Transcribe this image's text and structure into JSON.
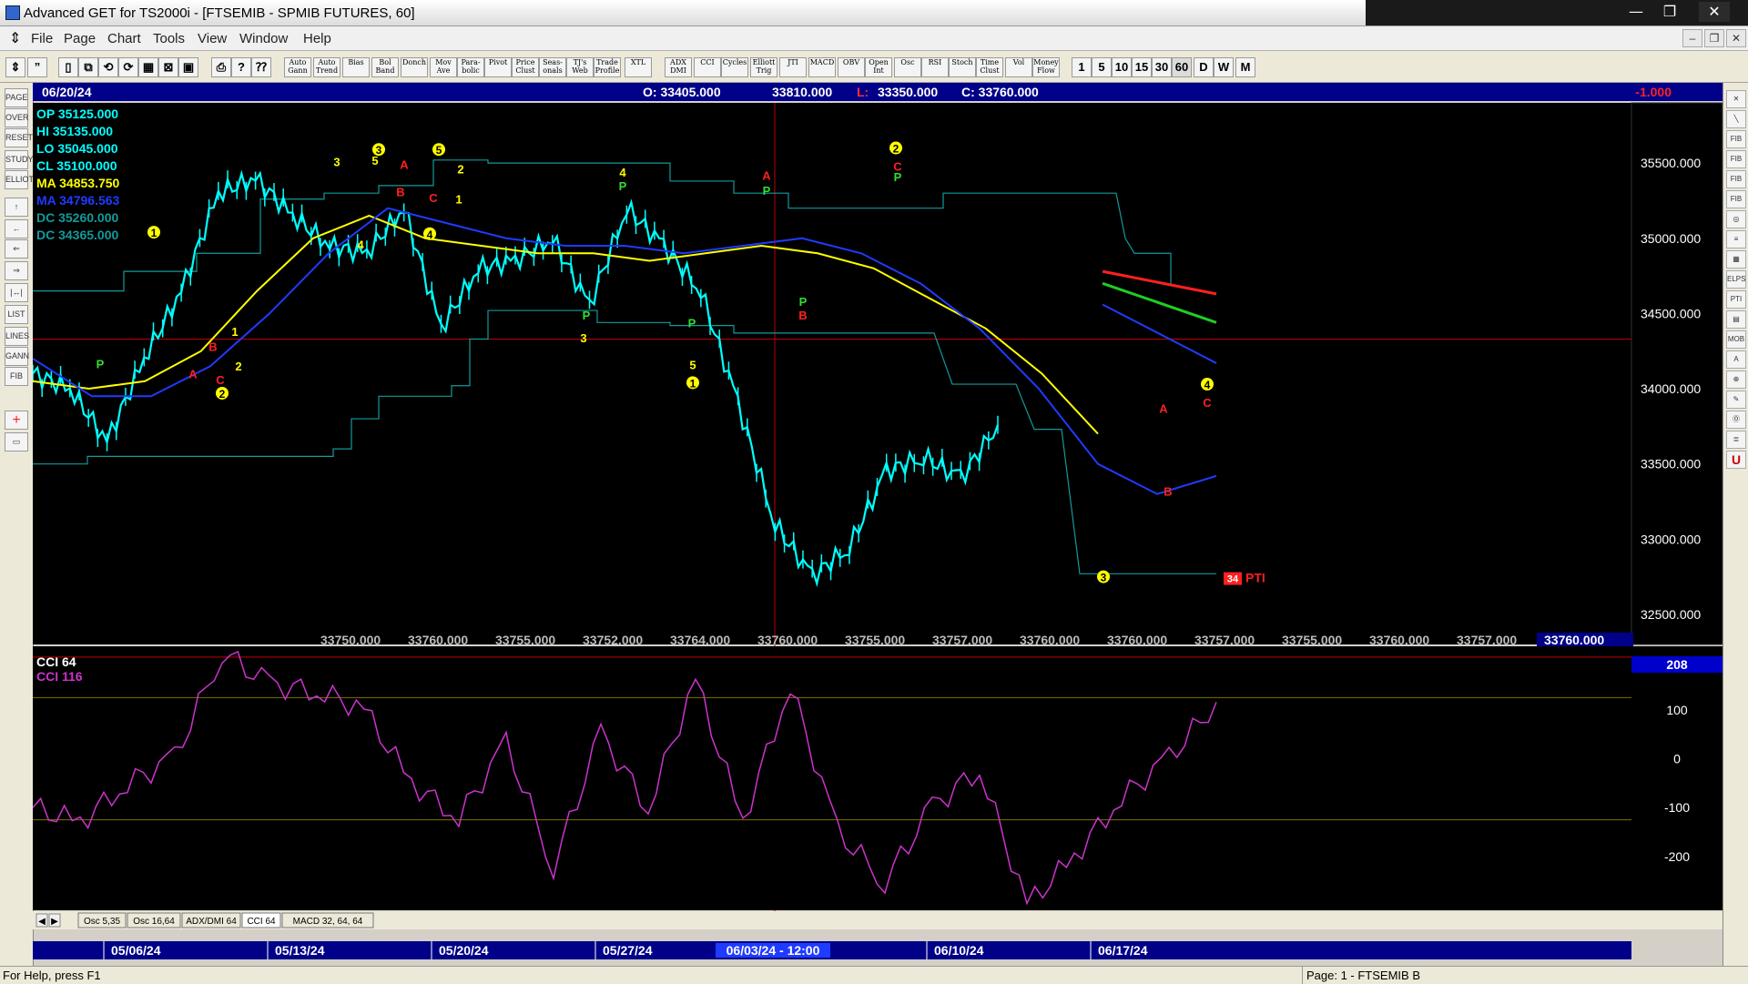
{
  "window": {
    "title": "Advanced GET for TS2000i - [FTSEMIB - SPMIB FUTURES, 60]",
    "controls": {
      "minimize": "—",
      "maximize": "❐",
      "close": "✕"
    },
    "mdi_controls": {
      "minimize": "–",
      "restore": "❐",
      "close": "✕"
    }
  },
  "menu": [
    "File",
    "Page",
    "Chart",
    "Tools",
    "View",
    "Window",
    "Help"
  ],
  "toolbar": {
    "study_buttons": [
      "Auto Gann",
      "Auto Trend",
      "Bias",
      "Bol Band",
      "Donch",
      "Mov Ave",
      "Para- bolic",
      "Pivot",
      "Price Clust",
      "Seas- onals",
      "TJ's Web",
      "Trade Profile",
      "XTL",
      "ADX DMI",
      "CCI",
      "Cycles",
      "Elliott Trig",
      "JTI",
      "MACD",
      "OBV",
      "Open Int",
      "Osc",
      "RSI",
      "Stoch",
      "Time Clust",
      "Vol",
      "Money Flow"
    ],
    "timeframes": [
      "1",
      "5",
      "10",
      "15",
      "30",
      "60",
      "D",
      "W",
      "M"
    ]
  },
  "leftbar": {
    "items": [
      "PAGE",
      "OVER",
      "RESET",
      "STUDY",
      "ELLIOT",
      "↑",
      "←",
      "⇐",
      "⇒",
      "|↔|",
      "LIST",
      "LINES",
      "GANN",
      "FIB",
      "+",
      "▭"
    ]
  },
  "rightbar": {
    "items": [
      "✕",
      "╲",
      "FIB",
      "FIB RET",
      "FIB EXT",
      "FIB TIME",
      "◎",
      "≡",
      "▦",
      "ELPS",
      "PTI",
      "▤",
      "MOB",
      "A",
      "⊕",
      "✎",
      "Ⓞ",
      "≣",
      "U"
    ]
  },
  "header": {
    "date": "06/20/24",
    "open": "O: 33405.000",
    "high": "33810.000",
    "low_label": "L:",
    "low": "33350.000",
    "close": "C: 33760.000",
    "change": "-1.000"
  },
  "legend": [
    {
      "label": "OP  35125.000",
      "color": "#00ffff"
    },
    {
      "label": "HI  35135.000",
      "color": "#00ffff"
    },
    {
      "label": "LO  35045.000",
      "color": "#00ffff"
    },
    {
      "label": "CL  35100.000",
      "color": "#00ffff"
    },
    {
      "label": "MA  34853.750",
      "color": "#ffff00"
    },
    {
      "label": "MA  34796.563",
      "color": "#1f3bff"
    },
    {
      "label": "DC  35260.000",
      "color": "#139a9a"
    },
    {
      "label": "DC  34365.000",
      "color": "#139a9a"
    }
  ],
  "price_axis": {
    "labels": [
      "35500.000",
      "35000.000",
      "34500.000",
      "34000.000",
      "33500.000",
      "33000.000",
      "32500.000"
    ]
  },
  "bottom_values": [
    "33750.000",
    "33760.000",
    "33755.000",
    "33752.000",
    "33764.000",
    "33760.000",
    "33755.000",
    "33757.000",
    "33760.000",
    "33760.000",
    "33757.000",
    "33755.000",
    "33760.000",
    "33757.000",
    "33760.000"
  ],
  "cci": {
    "title": "CCI 64",
    "value_label": "CCI  116",
    "current_value": "208",
    "axis": [
      "100",
      "0",
      "-100",
      "-200"
    ]
  },
  "tabs": [
    "Osc 5,35",
    "Osc 16,64",
    "ADX/DMI 64",
    "CCI 64",
    "MACD 32, 64, 64"
  ],
  "dates": {
    "labels": [
      "05/06/24",
      "05/13/24",
      "05/20/24",
      "05/27/24",
      "06/10/24",
      "06/17/24"
    ],
    "cursor": "06/03/24 - 12:00"
  },
  "pti": {
    "value": "34",
    "label": "PTI"
  },
  "status": {
    "left": "For Help, press F1",
    "right": "Page: 1 - FTSEMIB B"
  },
  "colors": {
    "cyan": "#00ffff",
    "yellow_ma": "#ffff00",
    "blue_ma": "#1f3bff",
    "donchian": "#139a9a",
    "cci": "#cc33cc",
    "wave_yellow": "#ffff00",
    "red": "#ff2020",
    "green": "#33dd33"
  },
  "chart_data": {
    "type": "line",
    "title": "FTSEMIB - SPMIB FUTURES, 60",
    "ylim": [
      32300,
      35900
    ],
    "x": [
      "05/06/24",
      "05/13/24",
      "05/20/24",
      "05/27/24",
      "06/03/24",
      "06/10/24",
      "06/17/24",
      "06/20/24"
    ],
    "series": [
      {
        "name": "Close",
        "values": [
          34100,
          34000,
          33650,
          34200,
          34650,
          35300,
          35400,
          35150,
          34950,
          34900,
          35200,
          34400,
          34800,
          34850,
          35000,
          34550,
          35200,
          34950,
          34650,
          33900,
          33100,
          32750,
          32950,
          33450,
          33550,
          33400,
          33760
        ]
      },
      {
        "name": "MA",
        "values": [
          34050,
          34000,
          34050,
          34250,
          34650,
          35000,
          35150,
          35000,
          34950,
          34900,
          34900,
          34850,
          34900,
          34950,
          34900,
          34800,
          34600,
          34400,
          34100,
          33700
        ]
      },
      {
        "name": "MA",
        "values": [
          34200,
          33950,
          33950,
          34150,
          34500,
          34900,
          35200,
          35100,
          35000,
          34950,
          34950,
          34900,
          34950,
          35000,
          34900,
          34700,
          34400,
          34000,
          33500,
          33300,
          33420
        ]
      },
      {
        "name": "CCI",
        "values": [
          -100,
          -130,
          -50,
          0,
          220,
          150,
          140,
          100,
          -50,
          -120,
          30,
          -220,
          50,
          -100,
          160,
          -130,
          150,
          -150,
          -250,
          -100,
          -20,
          -300,
          -200,
          -80,
          0,
          116
        ]
      }
    ],
    "cci_ylim": [
      -310,
      230
    ],
    "wave_labels": [
      "P",
      "1",
      "A",
      "B",
      "C",
      "2",
      "1",
      "2",
      "3",
      "5",
      "3",
      "A",
      "B",
      "C",
      "5",
      "4",
      "4",
      "2",
      "1",
      "P",
      "3",
      "4",
      "P",
      "5",
      "1",
      "A",
      "P",
      "P",
      "B",
      "2",
      "C",
      "P",
      "3",
      "4",
      "C",
      "A",
      "B"
    ]
  }
}
